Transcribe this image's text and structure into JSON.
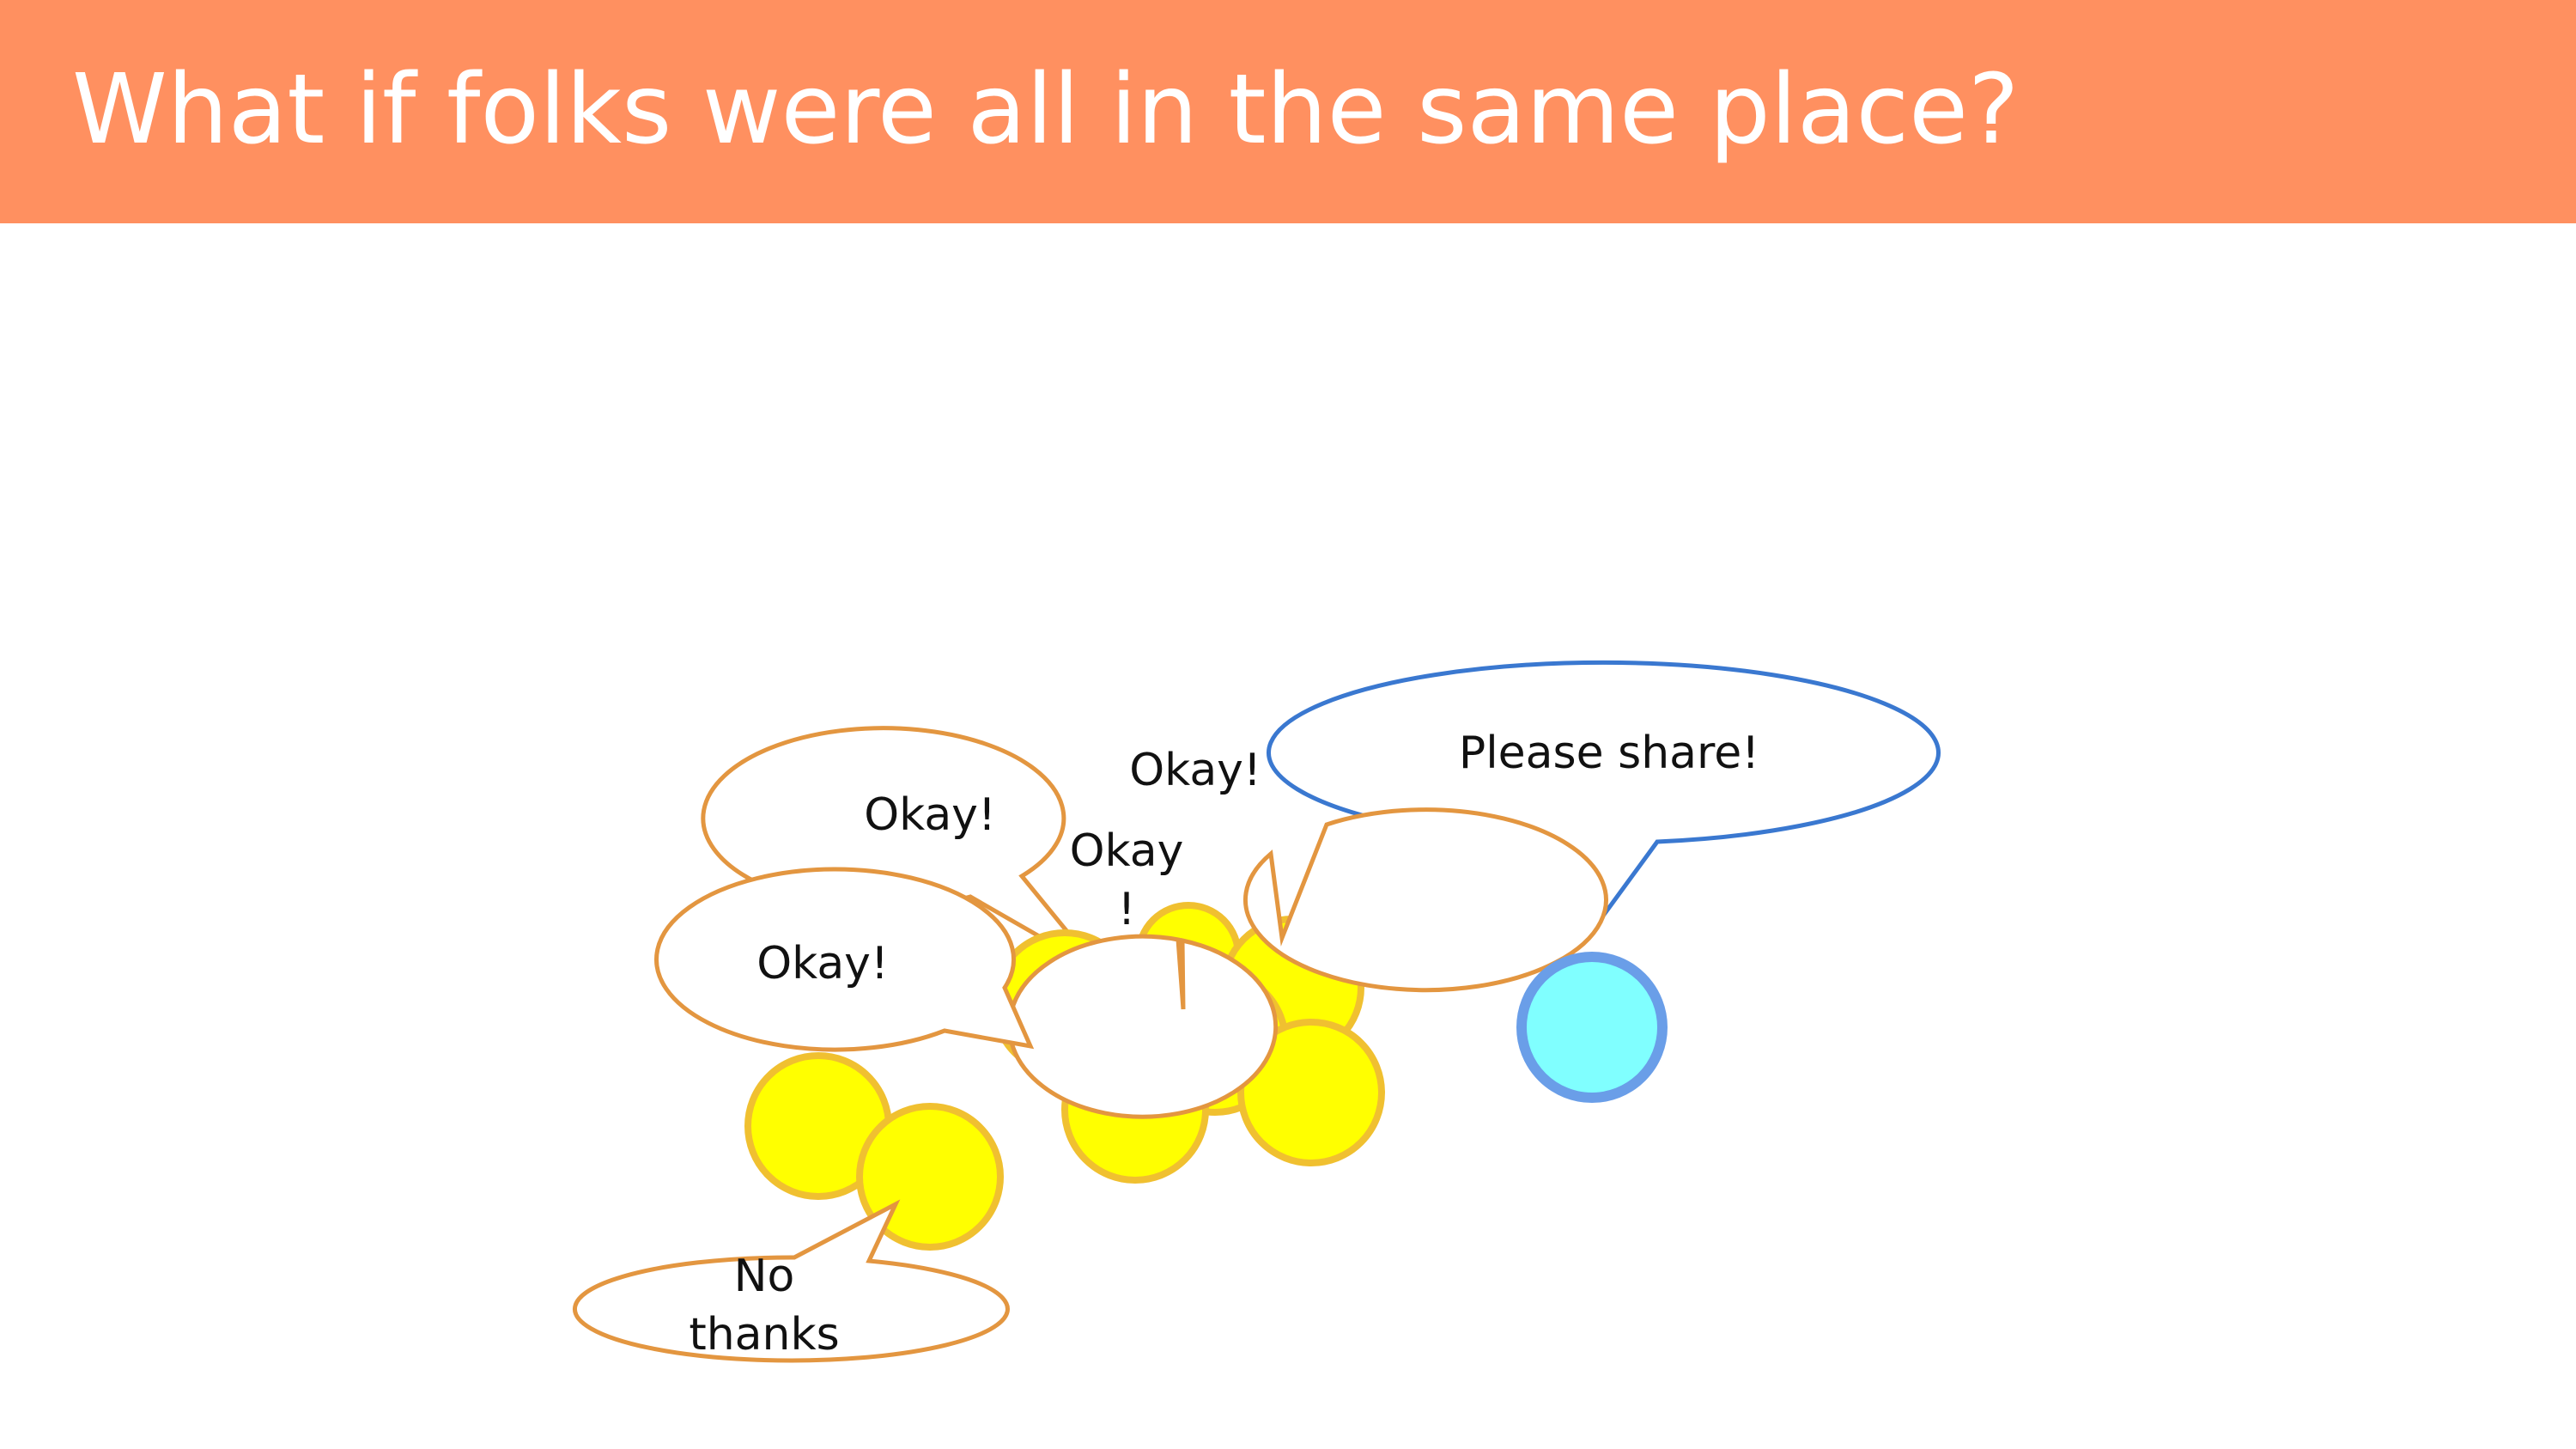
{
  "slide": {
    "title": "What if folks were all in the same place?"
  },
  "bubbles": {
    "okay_back": "Okay!",
    "okay_top": "Okay!",
    "okay_mid_line1": "Okay",
    "okay_mid_line2": "!",
    "okay_left": "Okay!",
    "please_share": "Please share!",
    "no_thanks_line1": "No",
    "no_thanks_line2": "thanks"
  },
  "colors": {
    "title_bar": "#ff9060",
    "title_text": "#ffffff",
    "crowd_fill": "#ffff00",
    "crowd_stroke": "#f0c030",
    "crowd_bubble_stroke": "#e39640",
    "speaker_fill": "#80ffff",
    "speaker_stroke": "#6a9ee8",
    "speaker_bubble_stroke": "#3a78d0"
  }
}
